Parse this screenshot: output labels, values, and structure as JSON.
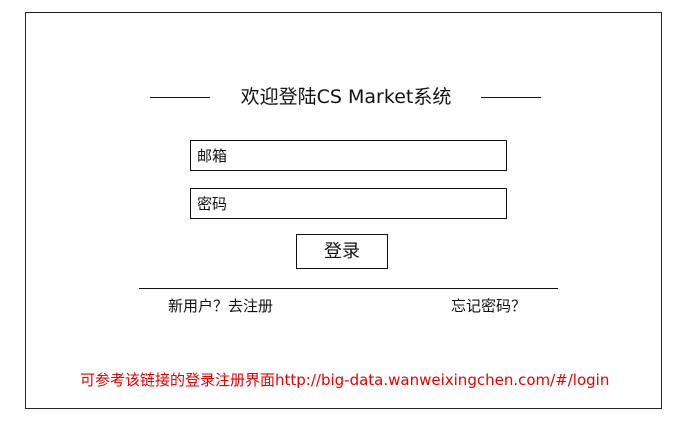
{
  "title": "欢迎登陆CS Market系统",
  "form": {
    "email_placeholder": "邮箱",
    "email_value": "",
    "password_placeholder": "密码",
    "password_value": "",
    "login_label": "登录"
  },
  "links": {
    "register": "新用户？去注册",
    "forgot_password": "忘记密码？"
  },
  "note": "可参考该链接的登录注册界面http://big-data.wanweixingchen.com/#/login",
  "colors": {
    "note_text": "#e60000",
    "border": "#111111",
    "background": "#ffffff"
  }
}
